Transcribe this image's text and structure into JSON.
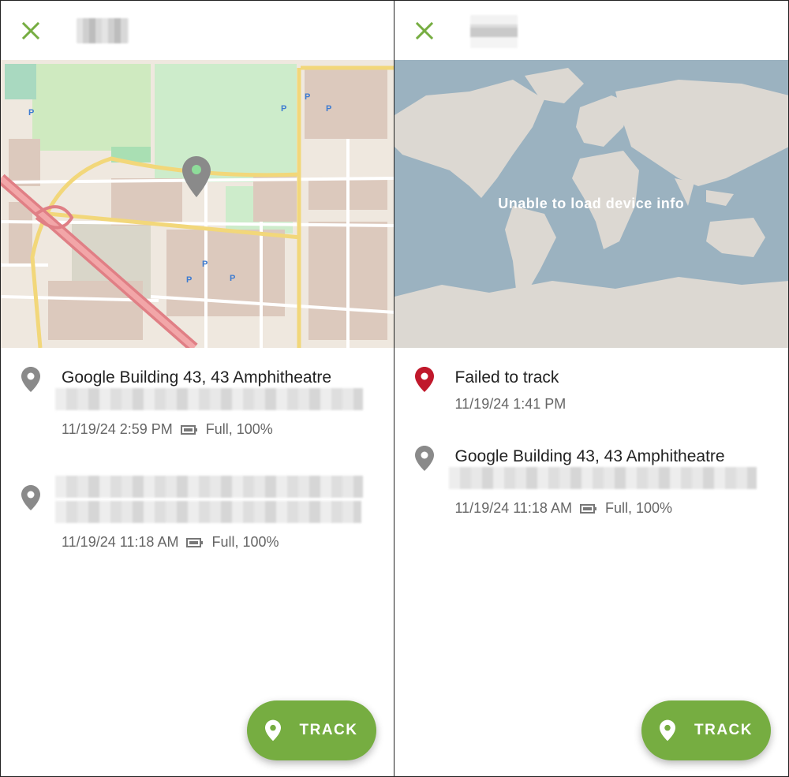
{
  "colors": {
    "accent": "#76ad41",
    "pin_gray": "#8a8a8a",
    "pin_red": "#c0182b",
    "water": "#9bb2c0",
    "land": "#dcd8d2"
  },
  "left": {
    "close_icon": "close-icon",
    "entries": [
      {
        "address": "Google Building 43, 43 Amphitheatre",
        "time": "11/19/24 2:59 PM",
        "battery": "Full, 100%"
      },
      {
        "time": "11/19/24 11:18 AM",
        "battery": "Full, 100%"
      }
    ],
    "fab_label": "TRACK"
  },
  "right": {
    "close_icon": "close-icon",
    "map_message": "Unable to load device info",
    "entries": [
      {
        "status": "Failed to track",
        "time": "11/19/24 1:41 PM"
      },
      {
        "address": "Google Building 43, 43 Amphitheatre",
        "time": "11/19/24 11:18 AM",
        "battery": "Full, 100%"
      }
    ],
    "fab_label": "TRACK"
  }
}
